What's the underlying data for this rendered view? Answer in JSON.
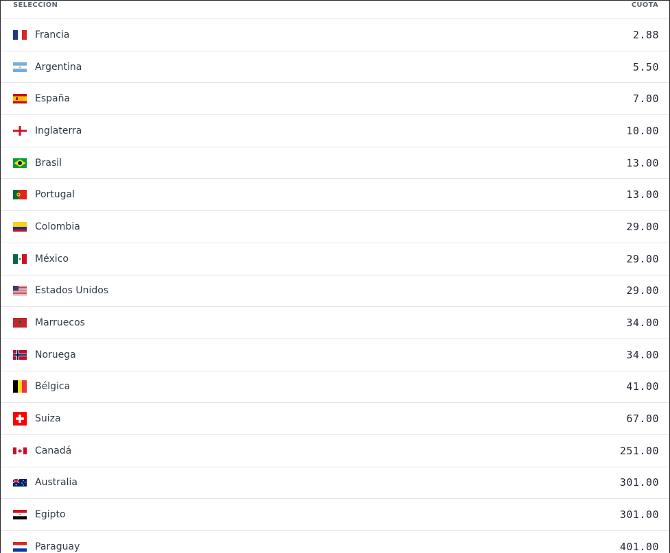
{
  "header": {
    "selection_label": "SELECCIÓN",
    "odds_label": "CUOTA"
  },
  "rows": [
    {
      "name": "Francia",
      "odds": "2.88",
      "flag": "france-flag-icon"
    },
    {
      "name": "Argentina",
      "odds": "5.50",
      "flag": "argentina-flag-icon"
    },
    {
      "name": "España",
      "odds": "7.00",
      "flag": "spain-flag-icon"
    },
    {
      "name": "Inglaterra",
      "odds": "10.00",
      "flag": "england-flag-icon"
    },
    {
      "name": "Brasil",
      "odds": "13.00",
      "flag": "brazil-flag-icon"
    },
    {
      "name": "Portugal",
      "odds": "13.00",
      "flag": "portugal-flag-icon"
    },
    {
      "name": "Colombia",
      "odds": "29.00",
      "flag": "colombia-flag-icon"
    },
    {
      "name": "México",
      "odds": "29.00",
      "flag": "mexico-flag-icon"
    },
    {
      "name": "Estados Unidos",
      "odds": "29.00",
      "flag": "usa-flag-icon"
    },
    {
      "name": "Marruecos",
      "odds": "34.00",
      "flag": "morocco-flag-icon"
    },
    {
      "name": "Noruega",
      "odds": "34.00",
      "flag": "norway-flag-icon"
    },
    {
      "name": "Bélgica",
      "odds": "41.00",
      "flag": "belgium-flag-icon"
    },
    {
      "name": "Suiza",
      "odds": "67.00",
      "flag": "switzerland-flag-icon"
    },
    {
      "name": "Canadá",
      "odds": "251.00",
      "flag": "canada-flag-icon"
    },
    {
      "name": "Australia",
      "odds": "301.00",
      "flag": "australia-flag-icon"
    },
    {
      "name": "Egipto",
      "odds": "301.00",
      "flag": "egypt-flag-icon"
    },
    {
      "name": "Paraguay",
      "odds": "401.00",
      "flag": "paraguay-flag-icon"
    }
  ]
}
